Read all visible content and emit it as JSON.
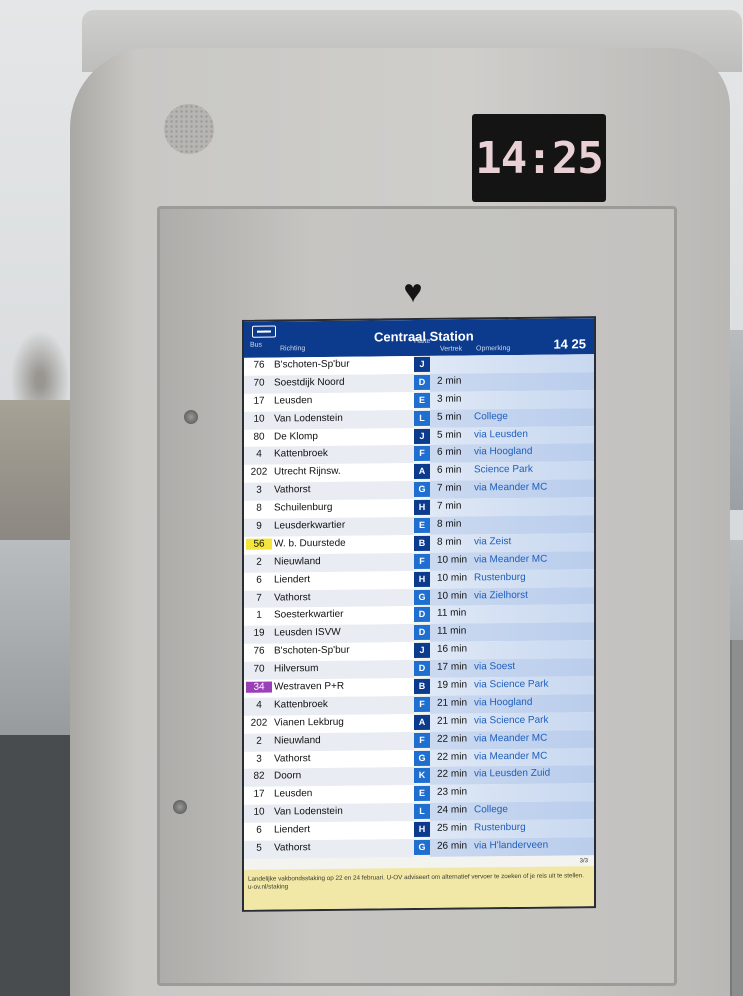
{
  "clock": {
    "time": "14:25"
  },
  "board": {
    "title": "Centraal Station",
    "time": "14 25",
    "columns": {
      "bus": "Bus",
      "richting": "Richting",
      "halte": "Halte",
      "vertrek": "Vertrek",
      "opmerking": "Opmerking"
    },
    "rows": [
      {
        "line": "76",
        "dest": "B'schoten-Sp'bur",
        "halte": "J",
        "vertrek": "",
        "remark": "",
        "highlight": ""
      },
      {
        "line": "70",
        "dest": "Soestdijk Noord",
        "halte": "D",
        "vertrek": "2 min",
        "remark": "",
        "highlight": ""
      },
      {
        "line": "17",
        "dest": "Leusden",
        "halte": "E",
        "vertrek": "3 min",
        "remark": "",
        "highlight": ""
      },
      {
        "line": "10",
        "dest": "Van Lodenstein",
        "halte": "L",
        "vertrek": "5 min",
        "remark": "College",
        "highlight": ""
      },
      {
        "line": "80",
        "dest": "De Klomp",
        "halte": "J",
        "vertrek": "5 min",
        "remark": "via Leusden",
        "highlight": ""
      },
      {
        "line": "4",
        "dest": "Kattenbroek",
        "halte": "F",
        "vertrek": "6 min",
        "remark": "via Hoogland",
        "highlight": ""
      },
      {
        "line": "202",
        "dest": "Utrecht Rijnsw.",
        "halte": "A",
        "vertrek": "6 min",
        "remark": "Science Park",
        "highlight": ""
      },
      {
        "line": "3",
        "dest": "Vathorst",
        "halte": "G",
        "vertrek": "7 min",
        "remark": "via Meander MC",
        "highlight": ""
      },
      {
        "line": "8",
        "dest": "Schuilenburg",
        "halte": "H",
        "vertrek": "7 min",
        "remark": "",
        "highlight": ""
      },
      {
        "line": "9",
        "dest": "Leusderkwartier",
        "halte": "E",
        "vertrek": "8 min",
        "remark": "",
        "highlight": ""
      },
      {
        "line": "56",
        "dest": "W. b. Duurstede",
        "halte": "B",
        "vertrek": "8 min",
        "remark": "via Zeist",
        "highlight": "yellow"
      },
      {
        "line": "2",
        "dest": "Nieuwland",
        "halte": "F",
        "vertrek": "10 min",
        "remark": "via Meander MC",
        "highlight": ""
      },
      {
        "line": "6",
        "dest": "Liendert",
        "halte": "H",
        "vertrek": "10 min",
        "remark": "Rustenburg",
        "highlight": ""
      },
      {
        "line": "7",
        "dest": "Vathorst",
        "halte": "G",
        "vertrek": "10 min",
        "remark": "via Zielhorst",
        "highlight": ""
      },
      {
        "line": "1",
        "dest": "Soesterkwartier",
        "halte": "D",
        "vertrek": "11 min",
        "remark": "",
        "highlight": ""
      },
      {
        "line": "19",
        "dest": "Leusden ISVW",
        "halte": "D",
        "vertrek": "11 min",
        "remark": "",
        "highlight": ""
      },
      {
        "line": "76",
        "dest": "B'schoten-Sp'bur",
        "halte": "J",
        "vertrek": "16 min",
        "remark": "",
        "highlight": ""
      },
      {
        "line": "70",
        "dest": "Hilversum",
        "halte": "D",
        "vertrek": "17 min",
        "remark": "via Soest",
        "highlight": ""
      },
      {
        "line": "34",
        "dest": "Westraven P+R",
        "halte": "B",
        "vertrek": "19 min",
        "remark": "via Science Park",
        "highlight": "purple"
      },
      {
        "line": "4",
        "dest": "Kattenbroek",
        "halte": "F",
        "vertrek": "21 min",
        "remark": "via Hoogland",
        "highlight": ""
      },
      {
        "line": "202",
        "dest": "Vianen Lekbrug",
        "halte": "A",
        "vertrek": "21 min",
        "remark": "via Science Park",
        "highlight": ""
      },
      {
        "line": "2",
        "dest": "Nieuwland",
        "halte": "F",
        "vertrek": "22 min",
        "remark": "via Meander MC",
        "highlight": ""
      },
      {
        "line": "3",
        "dest": "Vathorst",
        "halte": "G",
        "vertrek": "22 min",
        "remark": "via Meander MC",
        "highlight": ""
      },
      {
        "line": "82",
        "dest": "Doorn",
        "halte": "K",
        "vertrek": "22 min",
        "remark": "via Leusden Zuid",
        "highlight": ""
      },
      {
        "line": "17",
        "dest": "Leusden",
        "halte": "E",
        "vertrek": "23 min",
        "remark": "",
        "highlight": ""
      },
      {
        "line": "10",
        "dest": "Van Lodenstein",
        "halte": "L",
        "vertrek": "24 min",
        "remark": "College",
        "highlight": ""
      },
      {
        "line": "6",
        "dest": "Liendert",
        "halte": "H",
        "vertrek": "25 min",
        "remark": "Rustenburg",
        "highlight": ""
      },
      {
        "line": "5",
        "dest": "Vathorst",
        "halte": "G",
        "vertrek": "26 min",
        "remark": "via H'landerveen",
        "highlight": ""
      }
    ],
    "page": "3/3",
    "footer": "Landelijke vakbondsstaking op 22 en 24 februari. U-OV adviseert om alternatief vervoer te zoeken of je reis uit te stellen. u-ov.nl/staking"
  }
}
